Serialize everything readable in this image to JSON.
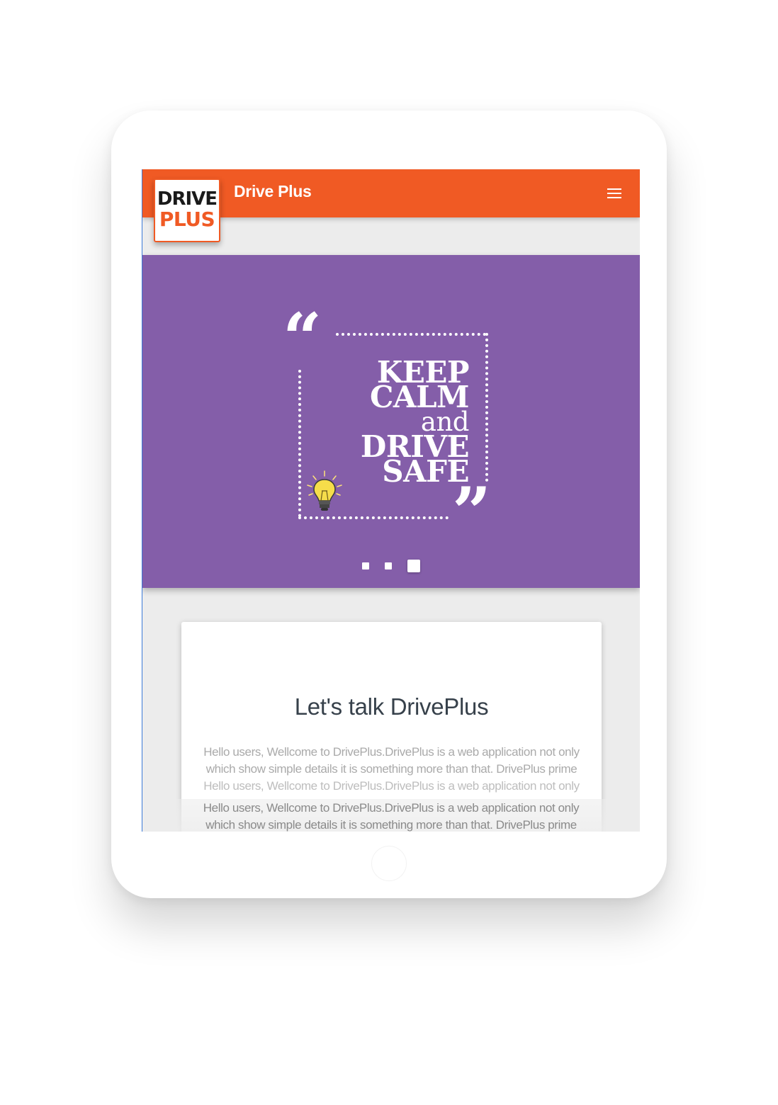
{
  "app": {
    "title": "Drive Plus",
    "logo": {
      "line1": "DRIVE",
      "line2": "PLUS"
    },
    "colors": {
      "brand": "#f05a24",
      "slider_bg": "#845ea9",
      "page_bg": "#ececec",
      "heading": "#37414b"
    }
  },
  "header": {
    "menu_icon": "hamburger-menu-icon"
  },
  "slider": {
    "quote_lines": [
      "KEEP",
      "CALM",
      "and",
      "DRIVE",
      "SAFE"
    ],
    "decor_icon": "lightbulb-icon",
    "slides_total": 3,
    "active_slide": 3
  },
  "card": {
    "title": "Let's talk DrivePlus",
    "body": [
      "Hello users, Wellcome to DrivePlus.DrivePlus is a web application not only",
      "which show simple details it is something more than that. DrivePlus prime",
      "Hello users, Wellcome to DrivePlus.DrivePlus is a web application not only"
    ],
    "overlay": [
      "Hello users, Wellcome to DrivePlus.DrivePlus is a web application not only",
      "which show simple details it is something more than that. DrivePlus prime"
    ]
  }
}
